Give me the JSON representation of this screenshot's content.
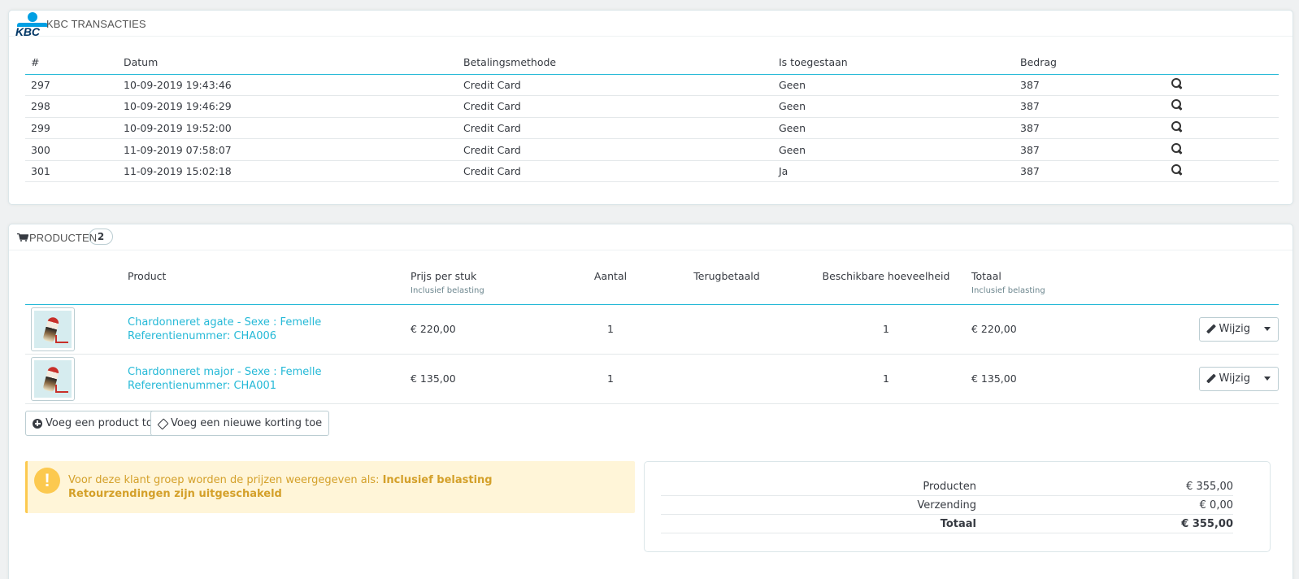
{
  "kbc": {
    "logo_text": "KBC",
    "title": "KBC TRANSACTIES",
    "columns": [
      "#",
      "Datum",
      "Betalingsmethode",
      "Is toegestaan",
      "Bedrag"
    ],
    "rows": [
      {
        "id": "297",
        "date": "10-09-2019 19:43:46",
        "method": "Credit Card",
        "allowed": "Geen",
        "amount": "387"
      },
      {
        "id": "298",
        "date": "10-09-2019 19:46:29",
        "method": "Credit Card",
        "allowed": "Geen",
        "amount": "387"
      },
      {
        "id": "299",
        "date": "10-09-2019 19:52:00",
        "method": "Credit Card",
        "allowed": "Geen",
        "amount": "387"
      },
      {
        "id": "300",
        "date": "11-09-2019 07:58:07",
        "method": "Credit Card",
        "allowed": "Geen",
        "amount": "387"
      },
      {
        "id": "301",
        "date": "11-09-2019 15:02:18",
        "method": "Credit Card",
        "allowed": "Ja",
        "amount": "387"
      }
    ]
  },
  "products": {
    "title": "PRODUCTEN",
    "count": "2",
    "columns": {
      "product": "Product",
      "unit_price": "Prijs per stuk",
      "unit_price_sub": "Inclusief belasting",
      "qty": "Aantal",
      "refunded": "Terugbetaald",
      "available": "Beschikbare hoeveelheid",
      "total": "Totaal",
      "total_sub": "Inclusief belasting"
    },
    "rows": [
      {
        "name": "Chardonneret agate - Sexe : Femelle",
        "ref": "Referentienummer: CHA006",
        "price": "€ 220,00",
        "qty": "1",
        "available": "1",
        "total": "€ 220,00",
        "edit": "Wijzig"
      },
      {
        "name": "Chardonneret major - Sexe : Femelle",
        "ref": "Referentienummer: CHA001",
        "price": "€ 135,00",
        "qty": "1",
        "available": "1",
        "total": "€ 135,00",
        "edit": "Wijzig"
      }
    ],
    "add_product": "Voeg een product toe",
    "add_discount": "Voeg een nieuwe korting toe"
  },
  "alert": {
    "line1_prefix": "Voor deze klant groep worden de prijzen weergegeven als: ",
    "line1_bold": "Inclusief belasting",
    "line2": "Retourzendingen zijn uitgeschakeld"
  },
  "totals": {
    "products_label": "Producten",
    "products_value": "€ 355,00",
    "shipping_label": "Verzending",
    "shipping_value": "€ 0,00",
    "total_label": "Totaal",
    "total_value": "€ 355,00"
  }
}
